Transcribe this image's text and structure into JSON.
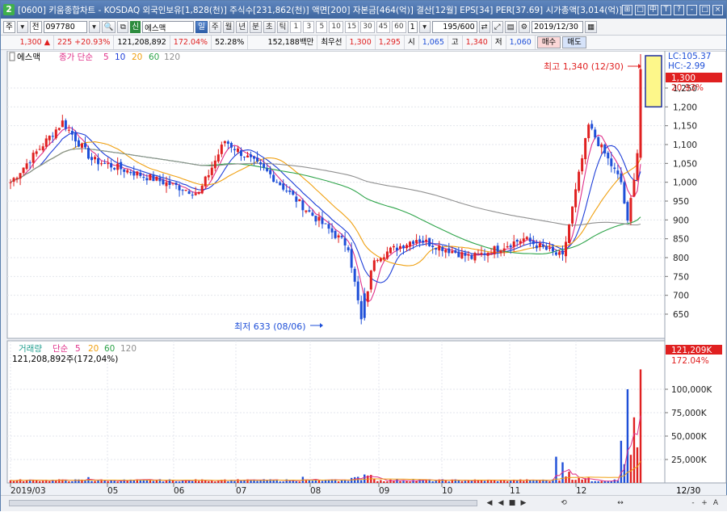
{
  "window": {
    "badge": "2",
    "title": "[0600] 키움종합차트 - KOSDAQ 외국인보유[1,828(천)] 주식수[231,862(천)] 액면[200] 자본금[464(억)] 결산[12월] EPS[34] PER[37.69] 시가총액[3,014(억)] 유통비율[81.",
    "controls": [
      "⊞",
      "□",
      "中",
      "T",
      "?",
      "-",
      "□",
      "×"
    ]
  },
  "toolbar": {
    "mode_label": "주",
    "period_label": "전",
    "code_value": "097780",
    "search_icon": "search-icon",
    "name_tag": "신",
    "stock_name": "에스맥",
    "period_buttons": [
      "일",
      "주",
      "월",
      "년",
      "분",
      "초",
      "틱"
    ],
    "active_period": "일",
    "interval_buttons": [
      "1",
      "3",
      "5",
      "10",
      "15",
      "30",
      "45",
      "60"
    ],
    "interval_select": "1",
    "count_value": "195/600",
    "date_value": "2019/12/30"
  },
  "quote": {
    "price": "1,300",
    "change": "225",
    "change_pct": "+20.93%",
    "volume": "121,208,892",
    "vol_ratio": "172.04%",
    "turnover": "52.28%",
    "amount": "152,188백만",
    "priority_label": "최우선",
    "ask": "1,300",
    "bid": "1,295",
    "open_label": "시",
    "open": "1,065",
    "high_label": "고",
    "high": "1,340",
    "low_label": "저",
    "low": "1,060",
    "buy_label": "매수",
    "sell_label": "매도"
  },
  "price_panel": {
    "stock_tag": "에스맥",
    "ma_label": "종가 단순",
    "ma_periods": [
      "5",
      "10",
      "20",
      "60",
      "120"
    ],
    "ma_colors": [
      "#e0308a",
      "#1e3ed8",
      "#f0a010",
      "#2ea44a",
      "#909090"
    ],
    "lc": "LC:105.37",
    "hc": "HC:-2.99",
    "cur_price": "1,300",
    "cur_pct": "20.93%",
    "high_note": "최고 1,340 (12/30)",
    "low_note": "최저 633 (08/06)",
    "y_ticks": [
      "1,250",
      "1,200",
      "1,150",
      "1,100",
      "1,050",
      "1,000",
      "950",
      "900",
      "850",
      "800",
      "750",
      "700",
      "650"
    ]
  },
  "volume_panel": {
    "title": "거래량",
    "ma_label": "단순",
    "ma_periods": [
      "5",
      "20",
      "60",
      "120"
    ],
    "summary": "121,208,892주(172,04%)",
    "cur_value": "121,209K",
    "cur_pct": "172.04%",
    "y_ticks": [
      "100,000K",
      "75,000K",
      "50,000K",
      "25,000K"
    ]
  },
  "x_axis": {
    "labels": [
      "2019/03",
      "05",
      "06",
      "07",
      "08",
      "09",
      "10",
      "11",
      "12"
    ],
    "end_label": "12/30"
  },
  "scroll_controls": [
    "◀",
    "◀",
    "■",
    "▶",
    "⟲",
    "↔",
    "-",
    "+",
    "A"
  ],
  "colors": {
    "up": "#e02020",
    "down": "#1e4fd8",
    "frame": "#5a7fae",
    "highlight": "#fdf78a"
  },
  "chart_data": {
    "type": "candlestick",
    "y_range": [
      633,
      1340
    ],
    "anchors": [
      {
        "date": "2019/03",
        "close": 1000
      },
      {
        "date": "2019/04",
        "close": 1160
      },
      {
        "date": "2019/04",
        "close": 1060
      },
      {
        "date": "2019/05",
        "close": 1020
      },
      {
        "date": "2019/06",
        "close": 970
      },
      {
        "date": "2019/06",
        "close": 1110
      },
      {
        "date": "2019/07",
        "close": 1020
      },
      {
        "date": "2019/07",
        "close": 920
      },
      {
        "date": "2019/08",
        "close": 830
      },
      {
        "date": "2019/08/06",
        "close": 633
      },
      {
        "date": "2019/08",
        "close": 800
      },
      {
        "date": "2019/09",
        "close": 850
      },
      {
        "date": "2019/10",
        "close": 800
      },
      {
        "date": "2019/10",
        "close": 850
      },
      {
        "date": "2019/11",
        "close": 800
      },
      {
        "date": "2019/11",
        "close": 1150
      },
      {
        "date": "2019/11",
        "close": 1000
      },
      {
        "date": "2019/12",
        "close": 890
      },
      {
        "date": "2019/12",
        "close": 1080
      },
      {
        "date": "2019/12/30",
        "close": 1300
      }
    ],
    "last": {
      "open": 1065,
      "high": 1340,
      "low": 1060,
      "close": 1300,
      "volume": 121208892
    },
    "volume_spikes_k": [
      100000,
      70000,
      121209
    ]
  }
}
